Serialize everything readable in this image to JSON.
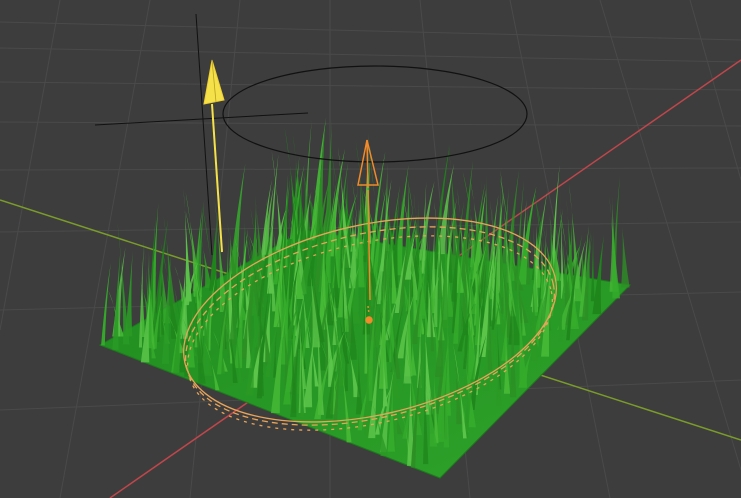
{
  "viewport": {
    "background": "#3d3d3d",
    "grid_color": "#4a4a4a",
    "x_axis_color": "#c0464b",
    "y_axis_color": "#7a9c2a"
  },
  "objects": [
    {
      "name": "grass-plane",
      "type": "mesh",
      "color": "#2e9a2a",
      "selected": false
    },
    {
      "name": "grass-blades",
      "type": "particle-hair",
      "color": "#3fae2d"
    },
    {
      "name": "circle-curve",
      "type": "curve",
      "color": "#e8a45a",
      "selected": true
    },
    {
      "name": "orange-empty",
      "type": "empty-arrow",
      "color": "#f08a2a",
      "selected": true
    },
    {
      "name": "yellow-empty",
      "type": "empty-arrow",
      "color": "#f5e14a",
      "selected": true,
      "active": true
    },
    {
      "name": "camera-ring",
      "type": "circle",
      "color": "#111111"
    }
  ]
}
